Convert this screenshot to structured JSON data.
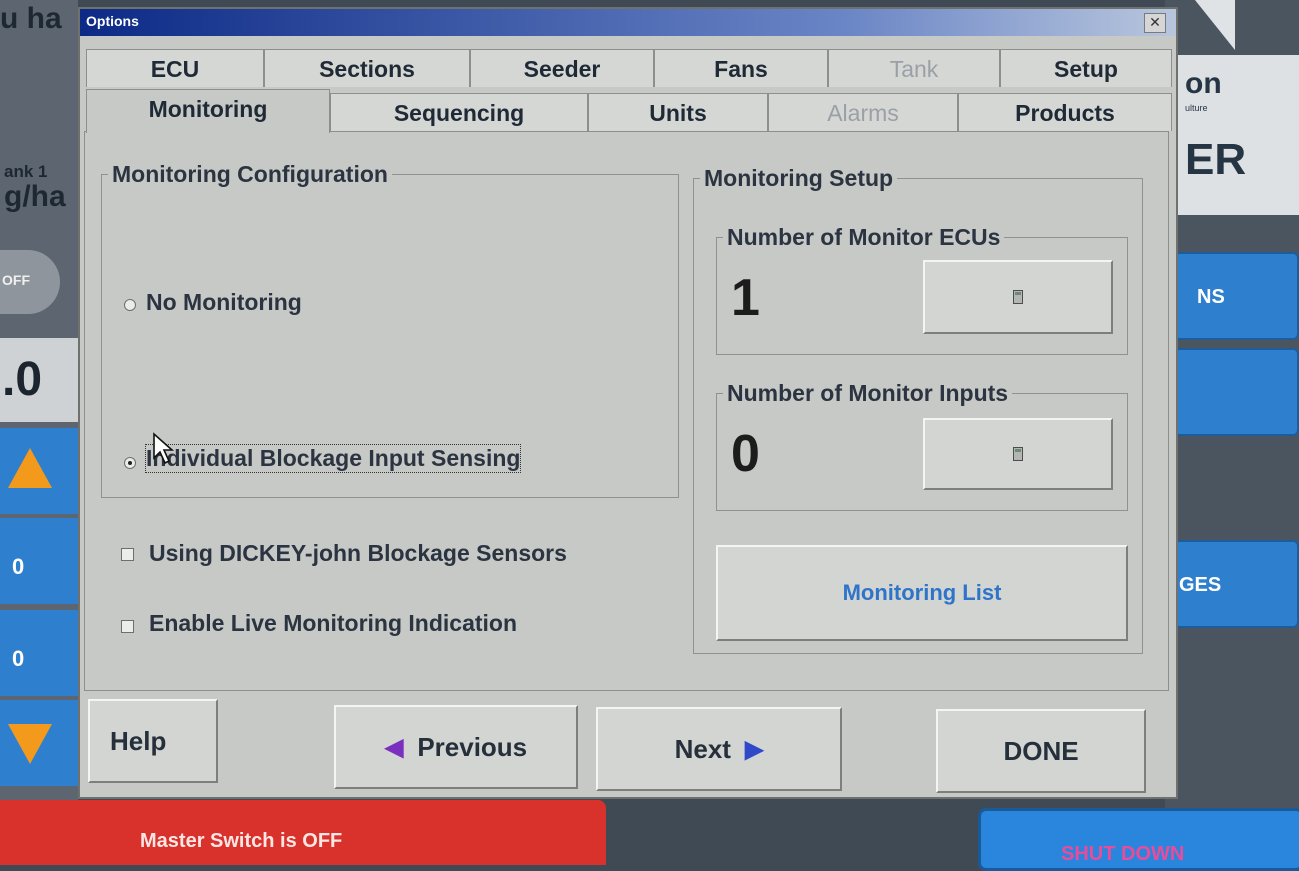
{
  "background": {
    "left_fragments": [
      "u ha",
      "ank 1",
      "g/ha",
      "OFF",
      ".0",
      "0",
      "0"
    ],
    "right_fragments": [
      "on",
      "ulture",
      "ER",
      "NS",
      "GES"
    ],
    "master_switch": "Master Switch is OFF",
    "shutdown": "SHUT DOWN"
  },
  "window": {
    "title": "Options",
    "close_glyph": "✕"
  },
  "tabs": {
    "row1": [
      {
        "label": "ECU",
        "enabled": true
      },
      {
        "label": "Sections",
        "enabled": true
      },
      {
        "label": "Seeder",
        "enabled": true
      },
      {
        "label": "Fans",
        "enabled": true
      },
      {
        "label": "Tank",
        "enabled": false
      },
      {
        "label": "Setup",
        "enabled": true
      }
    ],
    "row2": [
      {
        "label": "Monitoring",
        "enabled": true,
        "active": true
      },
      {
        "label": "Sequencing",
        "enabled": true
      },
      {
        "label": "Units",
        "enabled": true
      },
      {
        "label": "Alarms",
        "enabled": false
      },
      {
        "label": "Products",
        "enabled": true
      }
    ]
  },
  "monitoring_configuration": {
    "title": "Monitoring Configuration",
    "options": [
      {
        "label": "No Monitoring",
        "selected": false
      },
      {
        "label": "Individual Blockage Input Sensing",
        "selected": true
      }
    ]
  },
  "checkboxes": [
    {
      "label": "Using DICKEY-john Blockage Sensors",
      "checked": false
    },
    {
      "label": "Enable Live Monitoring Indication",
      "checked": false
    }
  ],
  "monitoring_setup": {
    "title": "Monitoring Setup",
    "ecus": {
      "title": "Number of Monitor ECUs",
      "value": "1",
      "icon": "calculator-icon"
    },
    "inputs": {
      "title": "Number of Monitor Inputs",
      "value": "0",
      "icon": "calculator-icon"
    },
    "list_button": "Monitoring List"
  },
  "footer": {
    "help": "Help",
    "previous": "Previous",
    "next": "Next",
    "done": "DONE",
    "prev_glyph": "◀",
    "next_glyph": "▶"
  },
  "colors": {
    "title_bar": "#0c2a86",
    "master_switch": "#d9312b",
    "shutdown": "#2a86dd",
    "accent_text": "#2e75c9"
  }
}
